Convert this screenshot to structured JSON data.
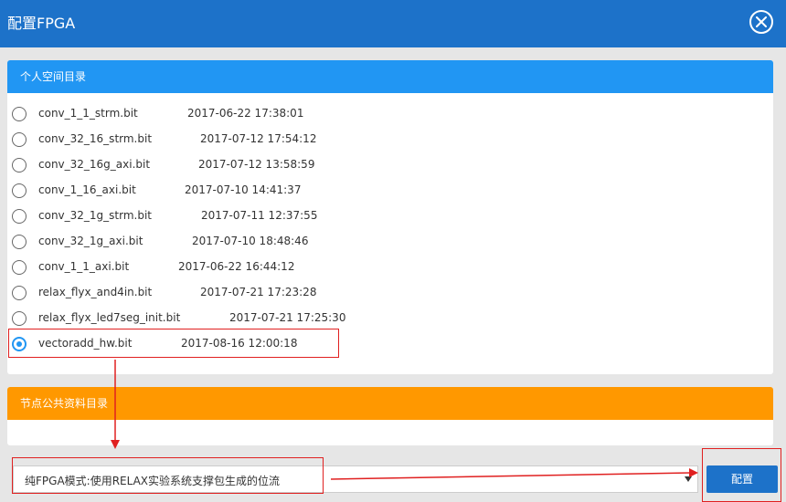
{
  "window": {
    "title": "配置FPGA"
  },
  "personal": {
    "header": "个人空间目录",
    "files": [
      {
        "name": "conv_1_1_strm.bit",
        "date": "2017-06-22 17:38:01"
      },
      {
        "name": "conv_32_16_strm.bit",
        "date": "2017-07-12 17:54:12"
      },
      {
        "name": "conv_32_16g_axi.bit",
        "date": "2017-07-12 13:58:59"
      },
      {
        "name": "conv_1_16_axi.bit",
        "date": "2017-07-10 14:41:37"
      },
      {
        "name": "conv_32_1g_strm.bit",
        "date": "2017-07-11 12:37:55"
      },
      {
        "name": "conv_32_1g_axi.bit",
        "date": "2017-07-10 18:48:46"
      },
      {
        "name": "conv_1_1_axi.bit",
        "date": "2017-06-22 16:44:12"
      },
      {
        "name": "relax_flyx_and4in.bit",
        "date": "2017-07-21 17:23:28"
      },
      {
        "name": "relax_flyx_led7seg_init.bit",
        "date": "2017-07-21 17:25:30"
      },
      {
        "name": "vectoradd_hw.bit",
        "date": "2017-08-16 12:00:18",
        "selected": true
      }
    ]
  },
  "public": {
    "header": "节点公共资料目录"
  },
  "mode_select": {
    "value": "纯FPGA模式:使用RELAX实验系统支撑包生成的位流"
  },
  "config_button": {
    "label": "配置"
  },
  "colors": {
    "primary": "#1d72c9",
    "personal_header": "#2196f3",
    "public_header": "#ff9800",
    "annotation": "#e02020"
  }
}
